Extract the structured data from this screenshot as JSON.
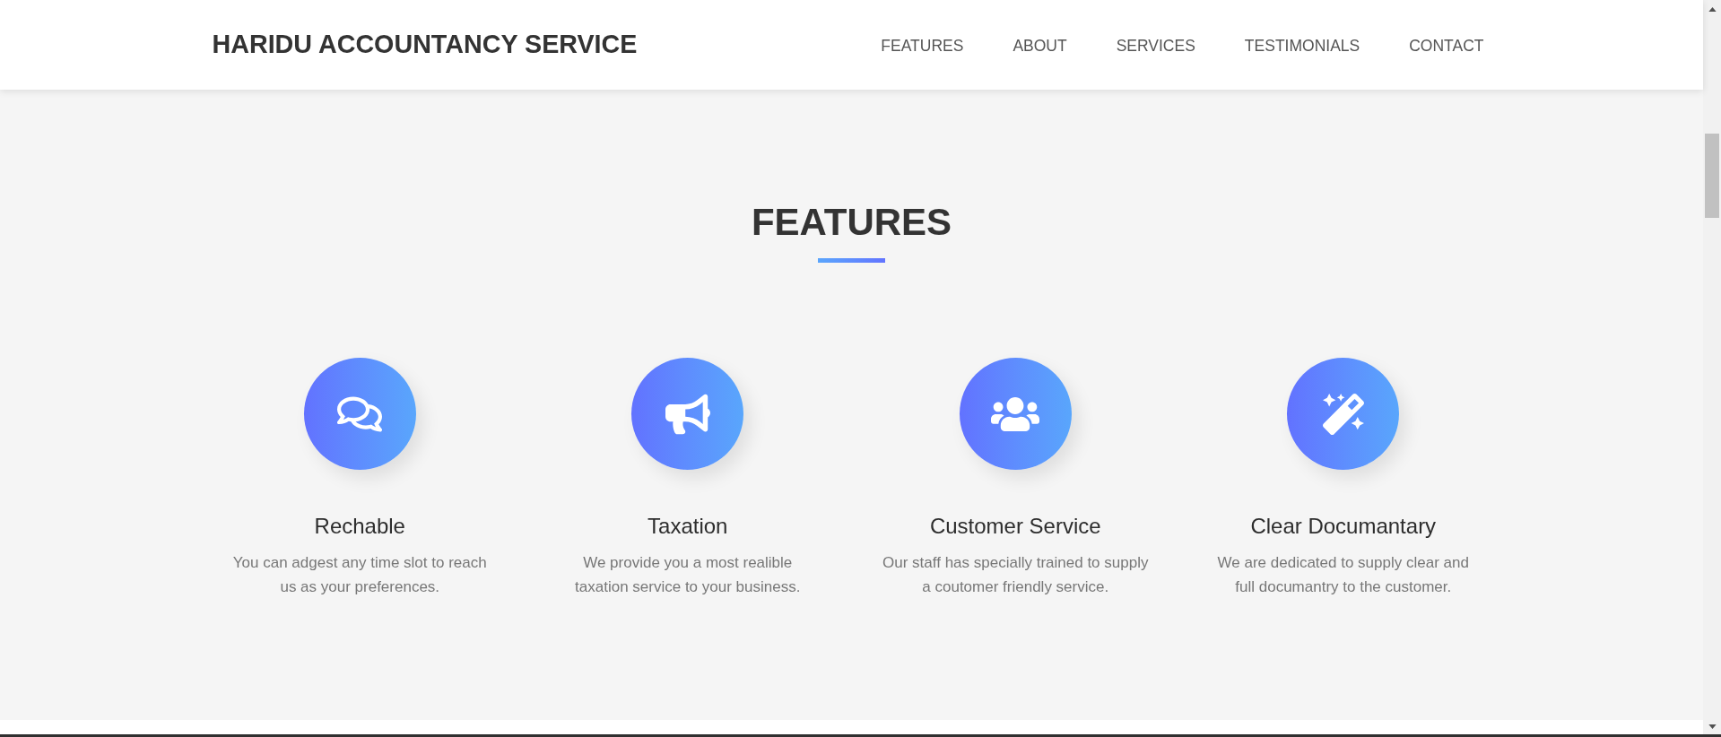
{
  "header": {
    "brand": "HARIDU ACCOUNTANCY SERVICE",
    "nav": [
      "FEATURES",
      "ABOUT",
      "SERVICES",
      "TESTIMONIALS",
      "CONTACT"
    ]
  },
  "features": {
    "title": "FEATURES",
    "items": [
      {
        "title": "Rechable",
        "description": "You can adgest any time slot to reach us as your preferences."
      },
      {
        "title": "Taxation",
        "description": "We provide you a most realible taxation service to your business."
      },
      {
        "title": "Customer Service",
        "description": "Our staff has specially trained to supply a coutomer friendly service."
      },
      {
        "title": "Clear Documantary",
        "description": "We are dedicated to supply clear and full documantry to the customer."
      }
    ]
  }
}
